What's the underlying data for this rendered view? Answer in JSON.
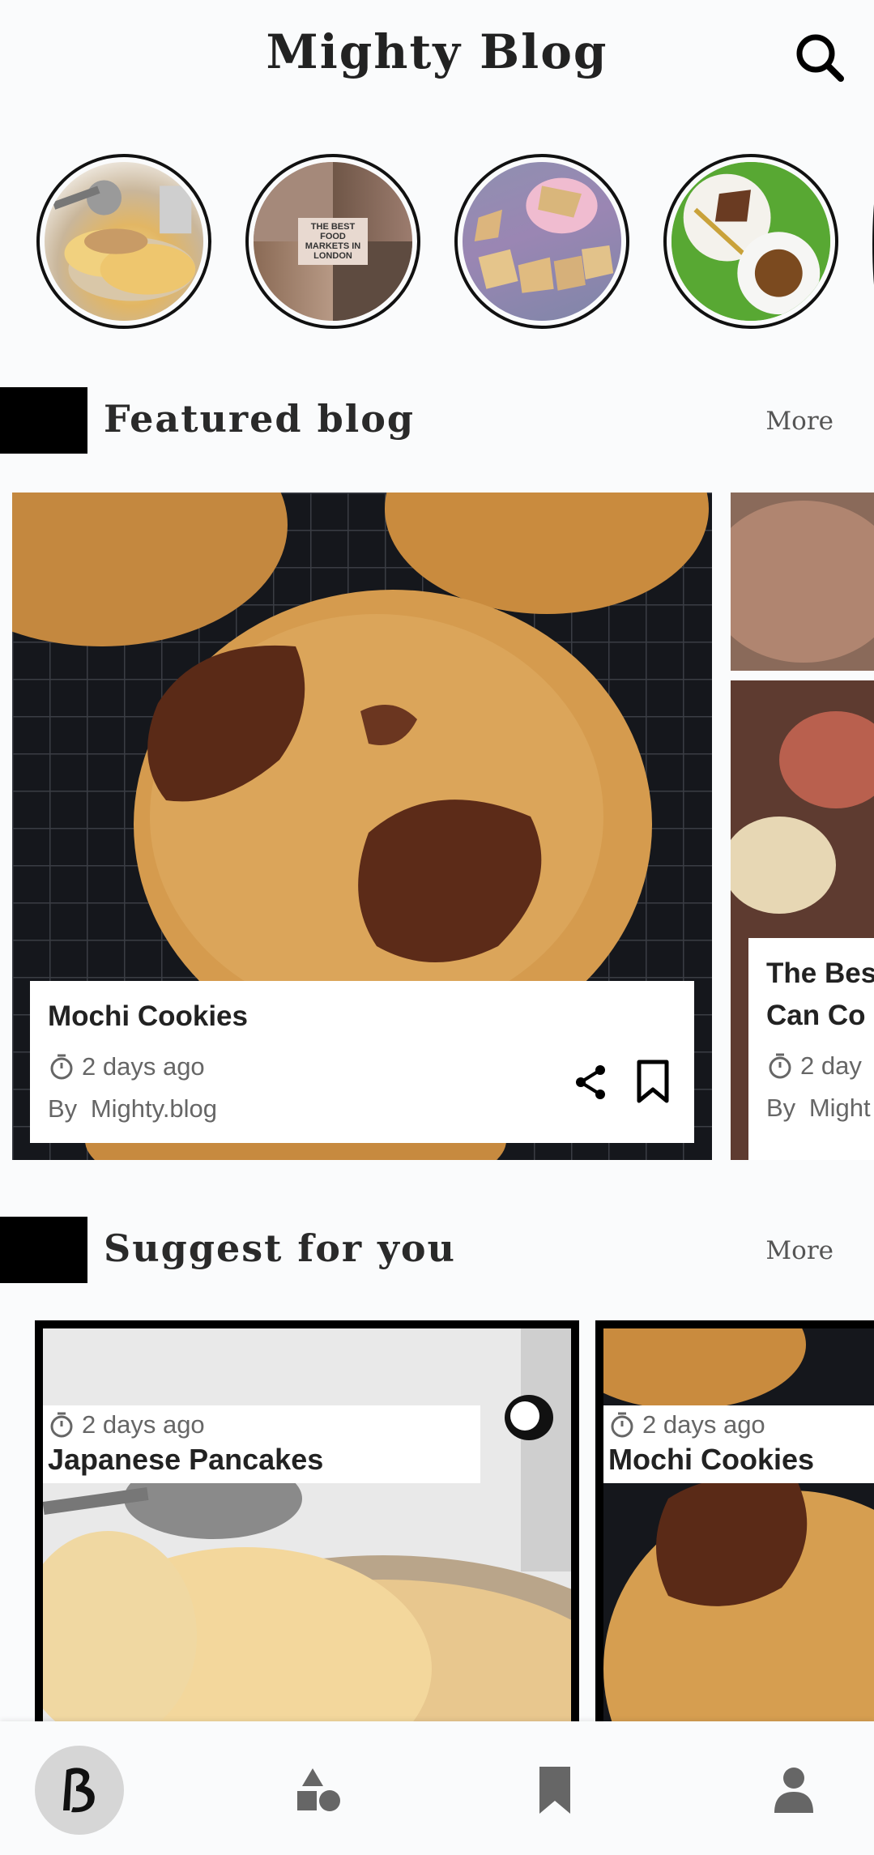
{
  "header": {
    "title": "Mighty Blog"
  },
  "stories": [
    {
      "name": "pancakes-story"
    },
    {
      "name": "food-markets-story",
      "overlay_text": "THE BEST FOOD MARKETS IN LONDON"
    },
    {
      "name": "cake-slices-story"
    },
    {
      "name": "brownie-tea-story"
    }
  ],
  "featured": {
    "title": "Featured blog",
    "more": "More",
    "cards": [
      {
        "title": "Mochi Cookies",
        "time": "2 days ago",
        "by": "By",
        "author": "Mighty.blog"
      },
      {
        "title_line1": "The Bes",
        "title_line2": "Can Co",
        "time": "2 day",
        "by": "By",
        "author": "Might"
      }
    ]
  },
  "suggest": {
    "title": "Suggest for you",
    "more": "More",
    "cards": [
      {
        "time": "2 days ago",
        "title": "Japanese Pancakes"
      },
      {
        "time": "2 days ago",
        "title": "Mochi Cookies"
      }
    ]
  },
  "bottom_nav": [
    {
      "icon": "blog-logo-icon",
      "active": true
    },
    {
      "icon": "categories-icon"
    },
    {
      "icon": "bookmark-icon"
    },
    {
      "icon": "profile-icon"
    }
  ],
  "colors": {
    "background": "#fafbfc",
    "accent": "#000000",
    "active_nav": "#d6d6d6",
    "icon_gray": "#666666"
  }
}
